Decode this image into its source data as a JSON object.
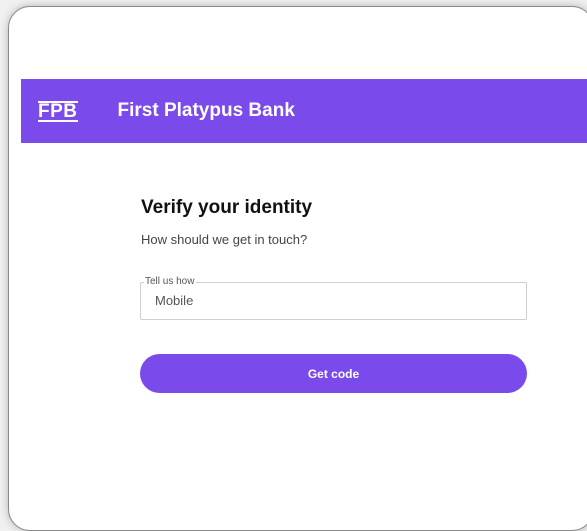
{
  "brand": {
    "logo": "FPB",
    "name": "First Platypus Bank",
    "color": "#7b4aea"
  },
  "main": {
    "title": "Verify your identity",
    "subtitle": "How should we get in touch?",
    "contact_field": {
      "label": "Tell us how",
      "value": "Mobile"
    },
    "submit_label": "Get code"
  }
}
